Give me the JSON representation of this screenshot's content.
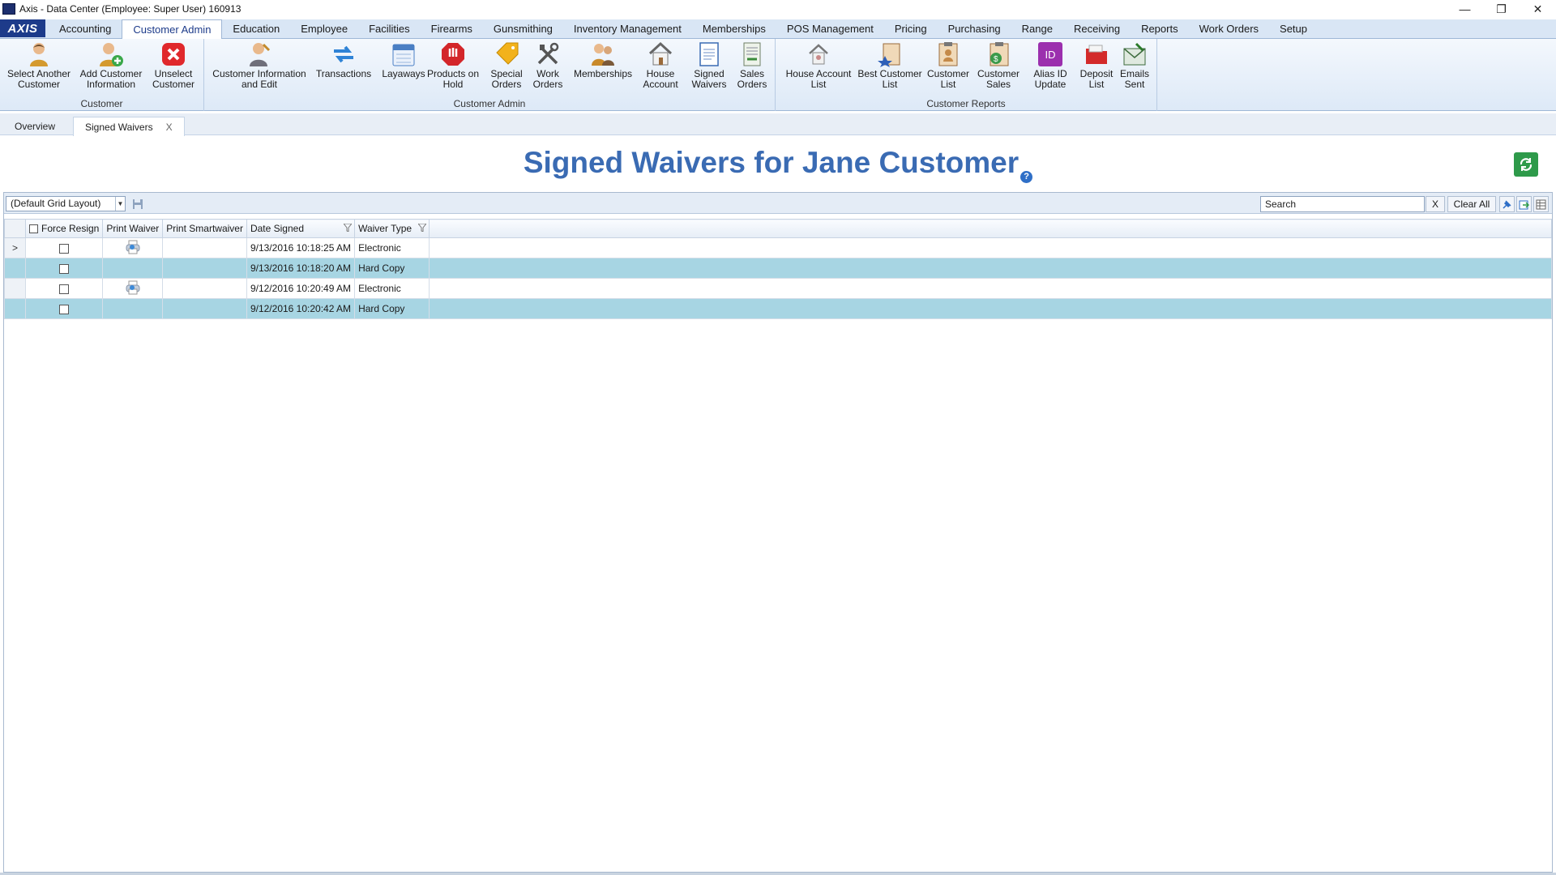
{
  "window": {
    "title": "Axis - Data Center  (Employee: Super User) 160913",
    "minimize": "—",
    "restore": "❐",
    "close": "✕"
  },
  "menu": {
    "logo": "AXIS",
    "tabs": [
      "Accounting",
      "Customer Admin",
      "Education",
      "Employee",
      "Facilities",
      "Firearms",
      "Gunsmithing",
      "Inventory Management",
      "Memberships",
      "POS Management",
      "Pricing",
      "Purchasing",
      "Range",
      "Receiving",
      "Reports",
      "Work Orders",
      "Setup"
    ],
    "active_tab": "Customer Admin"
  },
  "ribbon": {
    "groups": {
      "customer": "Customer",
      "customer_admin": "Customer Admin",
      "customer_reports": "Customer Reports"
    },
    "buttons": {
      "select_another": "Select Another\nCustomer",
      "add_customer": "Add Customer\nInformation",
      "unselect": "Unselect\nCustomer",
      "info_edit": "Customer Information\nand Edit",
      "transactions": "Transactions",
      "layaways": "Layaways",
      "products_hold": "Products on\nHold",
      "special_orders": "Special\nOrders",
      "work_orders": "Work\nOrders",
      "memberships": "Memberships",
      "house_account": "House\nAccount",
      "signed_waivers": "Signed\nWaivers",
      "sales_orders": "Sales\nOrders",
      "house_account_list": "House Account\nList",
      "best_customer_list": "Best Customer\nList",
      "customer_list": "Customer\nList",
      "customer_sales": "Customer\nSales",
      "alias_id_update": "Alias ID\nUpdate",
      "deposit_list": "Deposit\nList",
      "emails_sent": "Emails\nSent"
    },
    "icon_text": {
      "alias_id": "ID"
    }
  },
  "doc_tabs": {
    "overview": "Overview",
    "signed_waivers": "Signed Waivers",
    "close": "X"
  },
  "page": {
    "title": "Signed Waivers for Jane Customer",
    "help": "?"
  },
  "grid_toolbar": {
    "layout": "(Default Grid Layout)",
    "search_value": "Search",
    "search_clear": "X",
    "clear_all": "Clear All"
  },
  "grid": {
    "columns": [
      "Force Resign",
      "Print Waiver",
      "Print Smartwaiver",
      "Date Signed",
      "Waiver Type"
    ],
    "rows": [
      {
        "indicator": ">",
        "date_signed": "9/13/2016 10:18:25 AM",
        "waiver_type": "Electronic"
      },
      {
        "indicator": "",
        "date_signed": "9/13/2016 10:18:20 AM",
        "waiver_type": "Hard Copy"
      },
      {
        "indicator": "",
        "date_signed": "9/12/2016 10:20:49 AM",
        "waiver_type": "Electronic"
      },
      {
        "indicator": "",
        "date_signed": "9/12/2016 10:20:42 AM",
        "waiver_type": "Hard Copy"
      }
    ]
  },
  "colors": {
    "accent": "#3a6bb3",
    "row_highlight": "#a7d5e3",
    "refresh": "#2e9a4a"
  }
}
